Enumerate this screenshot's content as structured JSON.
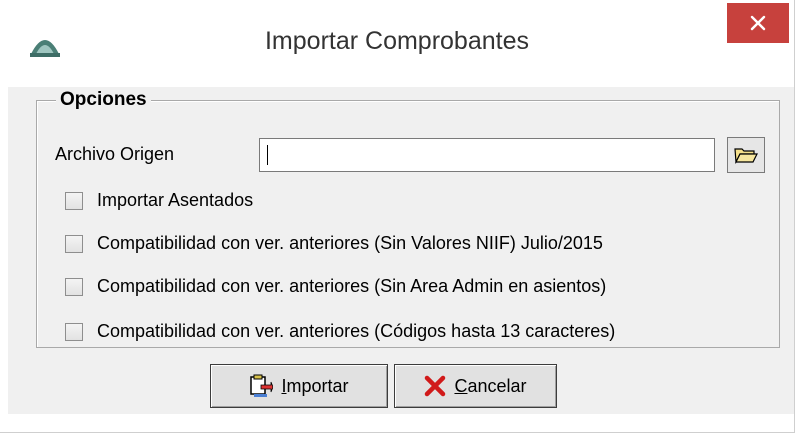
{
  "window": {
    "title": "Importar Comprobantes",
    "close_symbol": "×",
    "app_icon": "app-logo-icon",
    "accent_close_bg": "#c7413d"
  },
  "options": {
    "group_label": "Opciones",
    "source_file_label": "Archivo Origen",
    "source_file_value": "",
    "browse_icon": "folder-open-icon",
    "checkboxes": [
      {
        "label": "Importar Asentados",
        "checked": false
      },
      {
        "label": "Compatibilidad con ver. anteriores (Sin Valores NIIF) Julio/2015",
        "checked": false
      },
      {
        "label": "Compatibilidad con ver. anteriores (Sin Area Admin en asientos)",
        "checked": false
      },
      {
        "label": "Compatibilidad con ver. anteriores (Códigos hasta 13 caracteres)",
        "checked": false
      }
    ]
  },
  "buttons": {
    "import": {
      "first_letter": "I",
      "rest": "mportar",
      "icon": "import-icon"
    },
    "cancel": {
      "first_letter": "C",
      "rest": "ancelar",
      "icon": "red-x-icon"
    }
  }
}
